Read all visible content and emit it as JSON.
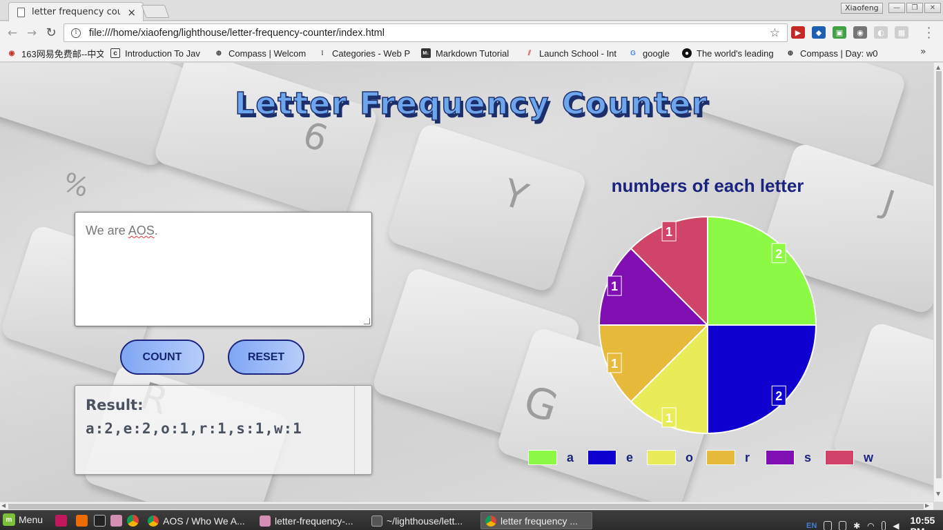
{
  "browser": {
    "tab_title": "letter frequency count",
    "tab_close": "×",
    "profile_name": "Xiaofeng",
    "url": "file:///home/xiaofeng/lighthouse/letter-frequency-counter/index.html"
  },
  "bookmarks": [
    {
      "label": "163网易免费邮--中文",
      "icon": "mail-163-icon",
      "color": "#c9302c"
    },
    {
      "label": "Introduction To Jav",
      "icon": "course-icon",
      "color": "#333333"
    },
    {
      "label": "Compass | Welcom",
      "icon": "compass-icon",
      "color": "#333333"
    },
    {
      "label": "Categories - Web P",
      "icon": "bookmark-dots-icon",
      "color": "#333333"
    },
    {
      "label": "Markdown Tutorial",
      "icon": "markdown-icon",
      "color": "#333333"
    },
    {
      "label": "Launch School - Int",
      "icon": "launch-school-icon",
      "color": "#d9534f"
    },
    {
      "label": "google",
      "icon": "google-icon",
      "color": "#4285f4"
    },
    {
      "label": "The world's leading",
      "icon": "github-icon",
      "color": "#111111"
    },
    {
      "label": "Compass | Day: w0",
      "icon": "compass-icon",
      "color": "#333333"
    }
  ],
  "page": {
    "title": "Letter Frequency Counter",
    "input_text_plain": "We are ",
    "input_text_misspelled": "AOS",
    "input_text_tail": ".",
    "count_label": "COUNT",
    "reset_label": "RESET",
    "result_label": "Result:",
    "result_value": "a:2,e:2,o:1,r:1,s:1,w:1"
  },
  "chart_data": {
    "type": "pie",
    "title": "numbers of each letter",
    "categories": [
      "a",
      "e",
      "o",
      "r",
      "s",
      "w"
    ],
    "values": [
      2,
      2,
      1,
      1,
      1,
      1
    ],
    "colors": [
      "#8cfa45",
      "#1000cf",
      "#e8ec58",
      "#e8ba3c",
      "#7f0eb3",
      "#cf4467"
    ],
    "legend_position": "bottom",
    "data_labels": true
  },
  "taskbar": {
    "menu_label": "Menu",
    "tasks": [
      {
        "label": "AOS / Who We A...",
        "icon": "chrome-icon",
        "active": false
      },
      {
        "label": "letter-frequency-...",
        "icon": "folder-icon",
        "active": false
      },
      {
        "label": "~/lighthouse/lett...",
        "icon": "editor-icon",
        "active": false
      },
      {
        "label": "letter frequency ...",
        "icon": "chrome-icon",
        "active": true
      }
    ],
    "keyboard_layout": "EN",
    "clock": "10:55 PM"
  }
}
